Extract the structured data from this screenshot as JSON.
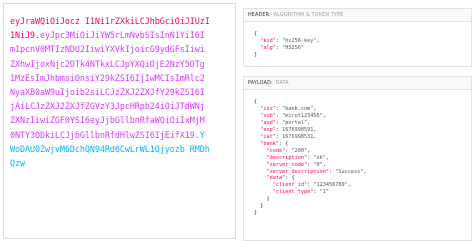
{
  "encoded": {
    "lines": [
      {
        "segments": [
          {
            "text": "eyJraWQiOiJocz I1Ni1rZXkiLCJhbGciOiJIUzI",
            "part": "header"
          }
        ]
      },
      {
        "segments": [
          {
            "text": "1NiJ9.",
            "part": "header"
          },
          {
            "text": "eyJpc3MiOiJiYW5rLmNvbSIsInN1YiI6I",
            "part": "payload"
          }
        ]
      },
      {
        "segments": [
          {
            "text": "m1pcnV0MTIzNDU2IiwiYXVkIjoicG9ydGFsIiwi",
            "part": "payload"
          }
        ]
      },
      {
        "segments": [
          {
            "text": "ZXhwIjoxNjc2OTk4NTkxLCJpYXQiOjE2NzY5OTg",
            "part": "payload"
          }
        ]
      },
      {
        "segments": [
          {
            "text": "1MzEsImJhbmsiOnsiY29kZSI6IjIwMCIsImRlc2",
            "part": "payload"
          }
        ]
      },
      {
        "segments": [
          {
            "text": "NyaXB0aW9uIjoib2siLCJzZXJ2ZXJfY29kZSI6I",
            "part": "payload"
          }
        ]
      },
      {
        "segments": [
          {
            "text": "jAiLCJzZXJ2ZXJfZGVzY3JpcHRpb24iOiJTdWNj",
            "part": "payload"
          }
        ]
      },
      {
        "segments": [
          {
            "text": "ZXNzIiwiZGF0YSI6eyJjbGllbnRfaWQiOiIxMjM",
            "part": "payload"
          }
        ]
      },
      {
        "segments": [
          {
            "text": "0NTY3ODkiLCJjbGllbnRfdHlwZSI6IjEifX19.",
            "part": "payload"
          },
          {
            "text": "Y",
            "part": "signature"
          }
        ]
      },
      {
        "segments": [
          {
            "text": "WoDAU0ZwjvM6DchQN94Rd6CwLrWL1Qjyozb RMDh",
            "part": "signature"
          }
        ]
      },
      {
        "segments": [
          {
            "text": "Qzw",
            "part": "signature"
          }
        ]
      }
    ]
  },
  "header_section": {
    "label": "HEADER:",
    "sublabel": "ALGORITHM & TOKEN TYPE",
    "json_lines": [
      [
        {
          "t": "{",
          "c": "p"
        }
      ],
      [
        {
          "t": "  \"kid\"",
          "c": "k"
        },
        {
          "t": ": ",
          "c": "p"
        },
        {
          "t": "\"hs256-key\"",
          "c": "v"
        },
        {
          "t": ",",
          "c": "p"
        }
      ],
      [
        {
          "t": "  \"alg\"",
          "c": "k"
        },
        {
          "t": ": ",
          "c": "p"
        },
        {
          "t": "\"HS256\"",
          "c": "v"
        }
      ],
      [
        {
          "t": "}",
          "c": "p"
        }
      ]
    ]
  },
  "payload_section": {
    "label": "PAYLOAD:",
    "sublabel": "DATA",
    "json_lines": [
      [
        {
          "t": "{",
          "c": "p"
        }
      ],
      [
        {
          "t": "  \"iss\"",
          "c": "k"
        },
        {
          "t": ": ",
          "c": "p"
        },
        {
          "t": "\"bank.com\"",
          "c": "v"
        },
        {
          "t": ",",
          "c": "p"
        }
      ],
      [
        {
          "t": "  \"sub\"",
          "c": "k"
        },
        {
          "t": ": ",
          "c": "p"
        },
        {
          "t": "\"mirut123456\"",
          "c": "v"
        },
        {
          "t": ",",
          "c": "p"
        }
      ],
      [
        {
          "t": "  \"aud\"",
          "c": "k"
        },
        {
          "t": ": ",
          "c": "p"
        },
        {
          "t": "\"portal\"",
          "c": "v"
        },
        {
          "t": ",",
          "c": "p"
        }
      ],
      [
        {
          "t": "  \"exp\"",
          "c": "k"
        },
        {
          "t": ": ",
          "c": "p"
        },
        {
          "t": "1676998591",
          "c": "v"
        },
        {
          "t": ",",
          "c": "p"
        }
      ],
      [
        {
          "t": "  \"iat\"",
          "c": "k"
        },
        {
          "t": ": ",
          "c": "p"
        },
        {
          "t": "1676998531",
          "c": "v"
        },
        {
          "t": ",",
          "c": "p"
        }
      ],
      [
        {
          "t": "  \"bank\"",
          "c": "k"
        },
        {
          "t": ": {",
          "c": "p"
        }
      ],
      [
        {
          "t": "    \"code\"",
          "c": "k"
        },
        {
          "t": ": ",
          "c": "p"
        },
        {
          "t": "\"200\"",
          "c": "v"
        },
        {
          "t": ",",
          "c": "p"
        }
      ],
      [
        {
          "t": "    \"description\"",
          "c": "k"
        },
        {
          "t": ": ",
          "c": "p"
        },
        {
          "t": "\"ok\"",
          "c": "v"
        },
        {
          "t": ",",
          "c": "p"
        }
      ],
      [
        {
          "t": "    \"server_code\"",
          "c": "k"
        },
        {
          "t": ": ",
          "c": "p"
        },
        {
          "t": "\"0\"",
          "c": "v"
        },
        {
          "t": ",",
          "c": "p"
        }
      ],
      [
        {
          "t": "    \"server_description\"",
          "c": "k"
        },
        {
          "t": ": ",
          "c": "p"
        },
        {
          "t": "\"Success\"",
          "c": "v"
        },
        {
          "t": ",",
          "c": "p"
        }
      ],
      [
        {
          "t": "    \"data\"",
          "c": "k"
        },
        {
          "t": ": {",
          "c": "p"
        }
      ],
      [
        {
          "t": "      \"client_id\"",
          "c": "k"
        },
        {
          "t": ": ",
          "c": "p"
        },
        {
          "t": "\"123456789\"",
          "c": "v"
        },
        {
          "t": ",",
          "c": "p"
        }
      ],
      [
        {
          "t": "      \"client_type\"",
          "c": "k"
        },
        {
          "t": ": ",
          "c": "p"
        },
        {
          "t": "\"1\"",
          "c": "v"
        }
      ],
      [
        {
          "t": "    }",
          "c": "p"
        }
      ],
      [
        {
          "t": "  }",
          "c": "p"
        }
      ],
      [
        {
          "t": "}",
          "c": "p"
        }
      ]
    ]
  },
  "colors": {
    "header_part": "#fb015b",
    "payload_part": "#d63aff",
    "signature_part": "#00b9f1"
  }
}
